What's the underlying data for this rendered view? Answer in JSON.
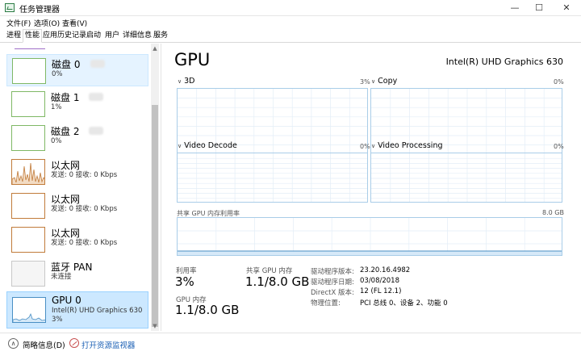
{
  "window": {
    "title": "任务管理器",
    "minimize": "—",
    "maximize": "☐",
    "close": "✕"
  },
  "menu": [
    "文件(F)",
    "选项(O)",
    "查看(V)"
  ],
  "tabs": [
    {
      "label": "进程",
      "active": false
    },
    {
      "label": "性能",
      "active": true
    },
    {
      "label": "应用历史记录",
      "active": false
    },
    {
      "label": "启动",
      "active": false
    },
    {
      "label": "用户",
      "active": false
    },
    {
      "label": "详细信息",
      "active": false
    },
    {
      "label": "服务",
      "active": false
    }
  ],
  "sidebar": {
    "items": [
      {
        "title": "磁盘 0",
        "lines": [
          "0%"
        ],
        "kind": "disk",
        "state": "hover"
      },
      {
        "title": "磁盘 1",
        "lines": [
          "1%"
        ],
        "kind": "disk",
        "state": ""
      },
      {
        "title": "磁盘 2",
        "lines": [
          "0%"
        ],
        "kind": "disk",
        "state": ""
      },
      {
        "title": "以太网",
        "lines": [
          "发送: 0 接收: 0 Kbps"
        ],
        "kind": "eth-active",
        "state": ""
      },
      {
        "title": "以太网",
        "lines": [
          "发送: 0 接收: 0 Kbps"
        ],
        "kind": "eth",
        "state": ""
      },
      {
        "title": "以太网",
        "lines": [
          "发送: 0 接收: 0 Kbps"
        ],
        "kind": "eth",
        "state": ""
      },
      {
        "title": "蓝牙 PAN",
        "lines": [
          "未连接"
        ],
        "kind": "bt",
        "state": ""
      },
      {
        "title": "GPU 0",
        "lines": [
          "Intel(R) UHD Graphics 630",
          "3%"
        ],
        "kind": "gpu",
        "state": "selected"
      }
    ]
  },
  "main": {
    "title": "GPU",
    "device_name": "Intel(R) UHD Graphics 630",
    "engines": [
      {
        "name": "3D",
        "percent": "3%"
      },
      {
        "name": "Copy",
        "percent": "0%"
      },
      {
        "name": "Video Decode",
        "percent": "0%"
      },
      {
        "name": "Video Processing",
        "percent": "0%"
      }
    ],
    "shared_memory": {
      "label": "共享 GPU 内存利用率",
      "max": "8.0 GB"
    },
    "stats": {
      "utilization_label": "利用率",
      "utilization_value": "3%",
      "shared_mem_label": "共享 GPU 内存",
      "shared_mem_value": "1.1/8.0 GB",
      "gpu_mem_label": "GPU 内存",
      "gpu_mem_value": "1.1/8.0 GB"
    },
    "details": [
      {
        "key": "驱动程序版本:",
        "value": "23.20.16.4982"
      },
      {
        "key": "驱动程序日期:",
        "value": "03/08/2018"
      },
      {
        "key": "DirectX 版本:",
        "value": "12 (FL 12.1)"
      },
      {
        "key": "物理位置:",
        "value": "PCI 总线 0、设备 2、功能 0"
      }
    ]
  },
  "footer": {
    "fewer_details": "简略信息(D)",
    "open_resmon": "打开资源监视器"
  },
  "colors": {
    "accent_blue": "#4a8fc4",
    "disk_green": "#7fb865",
    "eth_orange": "#c17b3a",
    "selected_bg": "#cce8ff"
  }
}
